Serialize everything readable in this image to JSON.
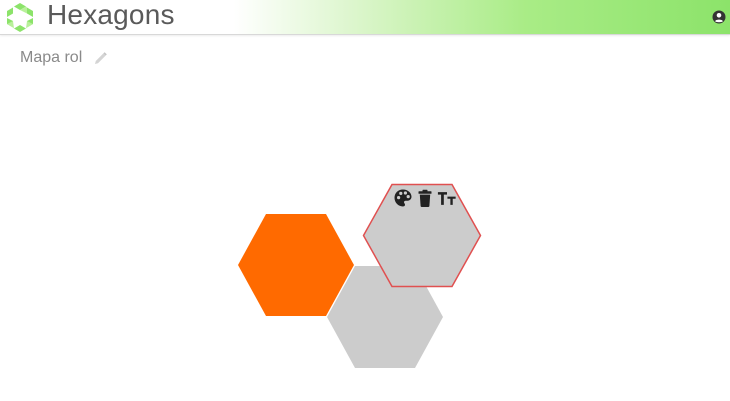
{
  "header": {
    "app_title": "Hexagons",
    "brand_color": "#8ce36a"
  },
  "map": {
    "title": "Mapa rol"
  },
  "hexagons": [
    {
      "id": "hex-orange",
      "fill": "#ff6a00",
      "selected": false
    },
    {
      "id": "hex-gray-bottom",
      "fill": "#cccccc",
      "selected": false
    },
    {
      "id": "hex-gray-selected",
      "fill": "#cccccc",
      "selected": true,
      "outline": "#e05050"
    }
  ],
  "hex_toolbar": {
    "icons": [
      "palette-icon",
      "trash-icon",
      "text-size-icon"
    ]
  }
}
